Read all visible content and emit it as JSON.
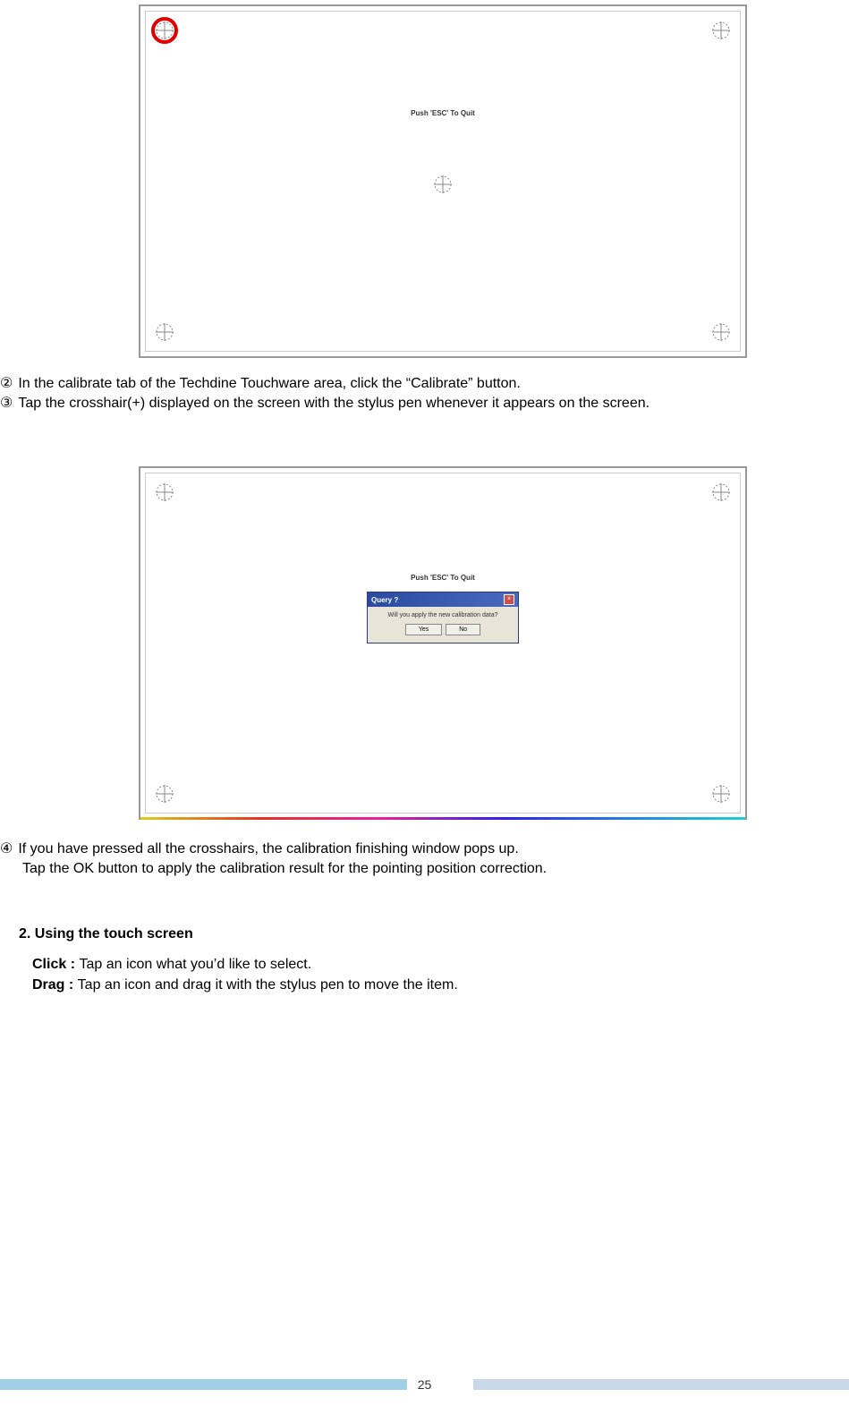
{
  "frame1": {
    "esc_text": "Push 'ESC' To Quit"
  },
  "frame2": {
    "esc_text": "Push 'ESC' To Quit",
    "dialog": {
      "title": "Query ?",
      "message": "Will you apply the new calibration data?",
      "yes": "Yes",
      "no": "No"
    }
  },
  "steps": {
    "n2": "②",
    "t2": "In the calibrate tab of the Techdine Touchware area, click the “Calibrate” button.",
    "n3": "③",
    "t3": "Tap the crosshair(+) displayed on the screen with the stylus pen whenever it appears on the screen.",
    "n4": "④",
    "t4a": "If you have pressed all the crosshairs, the calibration finishing window pops up.",
    "t4b": "Tap the OK button to apply the calibration result for the pointing position correction."
  },
  "section2": {
    "heading": "2. Using the touch screen",
    "click_label": "Click : ",
    "click_text": "Tap an icon what you’d like to select.",
    "drag_label": "Drag : ",
    "drag_text": "Tap an icon and drag it with the stylus pen to move the item."
  },
  "page_number": "25"
}
